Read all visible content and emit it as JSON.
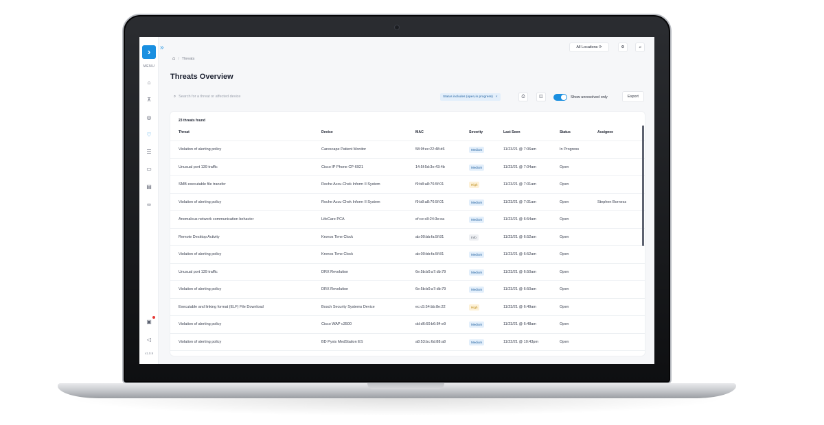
{
  "sidebar": {
    "menu_label": "MENU",
    "version": "v1.0.9",
    "icons": [
      "home-icon",
      "network-icon",
      "target-icon",
      "shield-icon",
      "database-icon",
      "monitor-icon",
      "report-icon",
      "link-icon",
      "gift-icon",
      "megaphone-icon"
    ]
  },
  "topbar": {
    "locations_label": "All Locations"
  },
  "breadcrumb": {
    "current": "Threats"
  },
  "page": {
    "title": "Threats Overview"
  },
  "toolbar": {
    "search_placeholder": "Search for a threat or affected device",
    "filter_chip": "Status includes (open,in progress)",
    "toggle_label": "Show unresolved only",
    "toggle_on": true,
    "export_label": "Export"
  },
  "table": {
    "count_label": "23 threats found",
    "headers": {
      "threat": "Threat",
      "device": "Device",
      "mac": "MAC",
      "severity": "Severity",
      "last_seen": "Last Seen",
      "status": "Status",
      "assignee": "Assignee"
    },
    "rows": [
      {
        "threat": "Violation of alerting policy",
        "device": "Carescape Patient Monitor",
        "mac": "58:9f:ec:22:48:d6",
        "severity": "Medium",
        "last_seen": "11/23/21 @ 7:06am",
        "status": "In Progress",
        "assignee": ""
      },
      {
        "threat": "Unusual port 139 traffic",
        "device": "Cisco IP Phone CP-6921",
        "mac": "14:5f:5d:3e:43:4b",
        "severity": "Medium",
        "last_seen": "11/23/21 @ 7:04am",
        "status": "Open",
        "assignee": ""
      },
      {
        "threat": "SMB executable file transfer",
        "device": "Roche Accu-Chek Inform II System",
        "mac": "f9:b8:a8:76:5f:01",
        "severity": "High",
        "last_seen": "11/23/21 @ 7:01am",
        "status": "Open",
        "assignee": ""
      },
      {
        "threat": "Violation of alerting policy",
        "device": "Roche Accu-Chek Inform II System",
        "mac": "f9:b8:a8:76:5f:01",
        "severity": "Medium",
        "last_seen": "11/23/21 @ 7:01am",
        "status": "Open",
        "assignee": "Stephen Borness"
      },
      {
        "threat": "Anomalous network communication behavior",
        "device": "LifeCare PCA",
        "mac": "ef:ce:c8:24:3e:ea",
        "severity": "Medium",
        "last_seen": "11/23/21 @ 6:54am",
        "status": "Open",
        "assignee": ""
      },
      {
        "threat": "Remote Desktop Activity",
        "device": "Kronos Time Clock",
        "mac": "ab:00:bb:fa:5f:81",
        "severity": "Info",
        "last_seen": "11/23/21 @ 6:52am",
        "status": "Open",
        "assignee": ""
      },
      {
        "threat": "Violation of alerting policy",
        "device": "Kronos Time Clock",
        "mac": "ab:00:bb:fa:5f:81",
        "severity": "Medium",
        "last_seen": "11/23/21 @ 6:52am",
        "status": "Open",
        "assignee": ""
      },
      {
        "threat": "Unusual port 139 traffic",
        "device": "DRX Revolution",
        "mac": "6e:5b:b0:a7:db:79",
        "severity": "Medium",
        "last_seen": "11/23/21 @ 6:50am",
        "status": "Open",
        "assignee": ""
      },
      {
        "threat": "Violation of alerting policy",
        "device": "DRX Revolution",
        "mac": "6e:5b:b0:a7:db:79",
        "severity": "Medium",
        "last_seen": "11/23/21 @ 6:50am",
        "status": "Open",
        "assignee": ""
      },
      {
        "threat": "Executable and linking format (ELF) File Download",
        "device": "Bosch Security Systems Device",
        "mac": "ec:c5:54:bb:8e:22",
        "severity": "High",
        "last_seen": "11/23/21 @ 6:49am",
        "status": "Open",
        "assignee": ""
      },
      {
        "threat": "Violation of alerting policy",
        "device": "Cisco WAP c3500",
        "mac": "dd:d6:60:b6:84:e9",
        "severity": "Medium",
        "last_seen": "11/23/21 @ 6:48am",
        "status": "Open",
        "assignee": ""
      },
      {
        "threat": "Violation of alerting policy",
        "device": "BD Pyxis MedStation ES",
        "mac": "a8:53:bc:6d:88:a8",
        "severity": "Medium",
        "last_seen": "11/22/21 @ 10:43pm",
        "status": "Open",
        "assignee": ""
      }
    ]
  },
  "colors": {
    "accent": "#1a8fe0",
    "medium_bg": "#e3effb",
    "medium_text": "#1f5f9e",
    "high_bg": "#fdf1d8",
    "high_text": "#b8860b",
    "info_bg": "#eef0f3",
    "info_text": "#555b68"
  }
}
